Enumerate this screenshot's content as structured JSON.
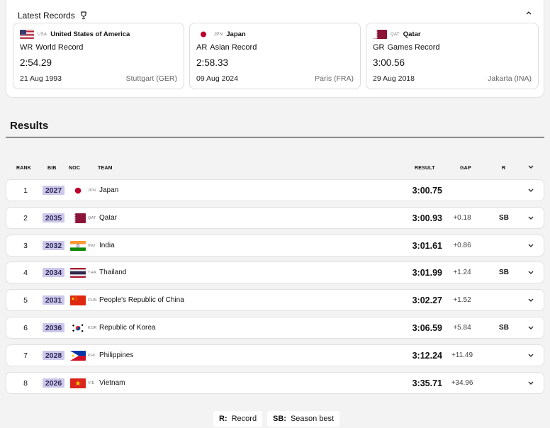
{
  "records": {
    "title": "Latest Records",
    "cards": [
      {
        "code": "USA",
        "country": "United States of America",
        "type_abbr": "WR",
        "type": "World Record",
        "time": "2:54.29",
        "date": "21 Aug 1993",
        "place": "Stuttgart (GER)"
      },
      {
        "code": "JPN",
        "country": "Japan",
        "type_abbr": "AR",
        "type": "Asian Record",
        "time": "2:58.33",
        "date": "09 Aug 2024",
        "place": "Paris (FRA)"
      },
      {
        "code": "QAT",
        "country": "Qatar",
        "type_abbr": "GR",
        "type": "Games Record",
        "time": "3:00.56",
        "date": "29 Aug 2018",
        "place": "Jakarta (INA)"
      }
    ]
  },
  "results": {
    "title": "Results",
    "columns": {
      "rank": "RANK",
      "bib": "BIB",
      "noc": "NOC",
      "team": "TEAM",
      "result": "RESULT",
      "gap": "GAP",
      "r": "R"
    },
    "rows": [
      {
        "rank": "1",
        "bib": "2027",
        "code": "JPN",
        "team": "Japan",
        "result": "3:00.75",
        "gap": "",
        "r": ""
      },
      {
        "rank": "2",
        "bib": "2035",
        "code": "QAT",
        "team": "Qatar",
        "result": "3:00.93",
        "gap": "+0.18",
        "r": "SB"
      },
      {
        "rank": "3",
        "bib": "2032",
        "code": "IND",
        "team": "India",
        "result": "3:01.61",
        "gap": "+0.86",
        "r": ""
      },
      {
        "rank": "4",
        "bib": "2034",
        "code": "THA",
        "team": "Thailand",
        "result": "3:01.99",
        "gap": "+1.24",
        "r": "SB"
      },
      {
        "rank": "5",
        "bib": "2031",
        "code": "CHN",
        "team": "People's Republic of China",
        "result": "3:02.27",
        "gap": "+1.52",
        "r": ""
      },
      {
        "rank": "6",
        "bib": "2036",
        "code": "KOR",
        "team": "Republic of Korea",
        "result": "3:06.59",
        "gap": "+5.84",
        "r": "SB"
      },
      {
        "rank": "7",
        "bib": "2028",
        "code": "PHI",
        "team": "Philippines",
        "result": "3:12.24",
        "gap": "+11.49",
        "r": ""
      },
      {
        "rank": "8",
        "bib": "2026",
        "code": "VIE",
        "team": "Vietnam",
        "result": "3:35.71",
        "gap": "+34.96",
        "r": ""
      }
    ]
  },
  "legend": {
    "r_key": "R:",
    "r_label": "Record",
    "sb_key": "SB:",
    "sb_label": "Season best"
  },
  "colors": {
    "bib_bg": "#cdc7ea",
    "japan_red": "#bc002d",
    "qatar_maroon": "#8a1538"
  }
}
